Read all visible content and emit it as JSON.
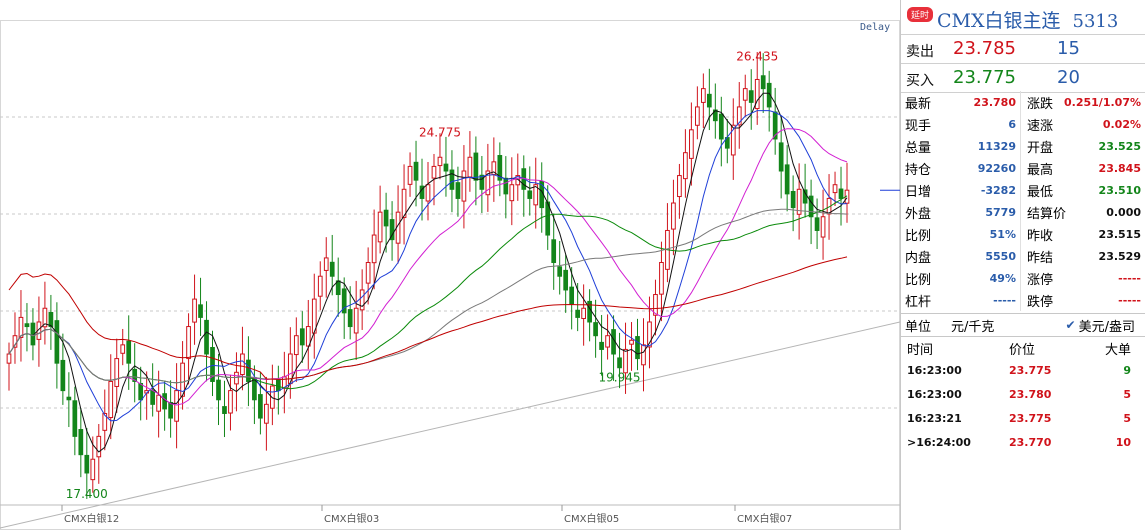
{
  "chart_data": {
    "type": "candlestick",
    "delay_label": "Delay",
    "x_labels": [
      "CMX白银12",
      "CMX白银03",
      "CMX白银05",
      "CMX白银07"
    ],
    "extrema_labels": [
      {
        "text": "17.400",
        "value": 17.4,
        "kind": "low"
      },
      {
        "text": "24.775",
        "value": 24.775,
        "kind": "high"
      },
      {
        "text": "19.945",
        "value": 19.945,
        "kind": "low"
      },
      {
        "text": "26.435",
        "value": 26.435,
        "kind": "high"
      }
    ],
    "y_range": [
      16.9,
      27.5
    ],
    "grid": true,
    "last_price": 23.78,
    "ma_colors": [
      "#111111",
      "#1f3fd8",
      "#d21fd2",
      "#0a8a0a",
      "#7a7a7a",
      "#c00000"
    ],
    "up_color": "#d0131b",
    "down_color": "#13851a",
    "closes": [
      20.2,
      20.6,
      21.0,
      20.8,
      20.4,
      20.9,
      21.2,
      20.8,
      20.0,
      19.4,
      19.2,
      18.4,
      18.0,
      17.6,
      17.9,
      18.4,
      18.9,
      19.6,
      20.1,
      20.4,
      20.0,
      19.6,
      19.2,
      19.4,
      19.1,
      19.3,
      19.0,
      18.8,
      19.4,
      20.0,
      20.8,
      21.4,
      21.0,
      20.2,
      19.6,
      19.2,
      18.9,
      19.4,
      19.8,
      20.2,
      19.6,
      19.2,
      18.8,
      19.1,
      19.5,
      19.4,
      19.7,
      20.2,
      20.6,
      20.4,
      20.8,
      21.4,
      21.9,
      22.3,
      21.9,
      21.5,
      21.1,
      20.8,
      21.2,
      21.6,
      22.2,
      22.8,
      23.3,
      23.0,
      22.7,
      23.3,
      23.8,
      24.3,
      24.0,
      23.6,
      23.9,
      24.3,
      24.5,
      24.2,
      23.8,
      23.6,
      24.2,
      24.5,
      24.0,
      23.8,
      24.2,
      24.4,
      24.0,
      23.7,
      23.9,
      24.1,
      23.8,
      23.6,
      23.9,
      23.4,
      22.8,
      22.2,
      21.9,
      21.6,
      21.3,
      21.0,
      21.2,
      20.9,
      20.6,
      20.3,
      20.6,
      20.2,
      19.9,
      20.3,
      20.5,
      20.1,
      20.4,
      20.9,
      21.5,
      22.2,
      22.9,
      23.5,
      24.1,
      24.6,
      25.1,
      25.6,
      26.0,
      25.6,
      25.3,
      24.9,
      24.7,
      25.2,
      25.6,
      26.0,
      25.7,
      26.2,
      26.0,
      25.6,
      24.9,
      24.2,
      23.7,
      23.4,
      23.8,
      23.5,
      23.2,
      22.9,
      23.2,
      23.6,
      23.9,
      23.6,
      23.78
    ]
  },
  "panel": {
    "tag": "延时",
    "title": "CMX白银主连",
    "code": "5313",
    "sell": {
      "label": "卖出",
      "price": "23.785",
      "volume": "15"
    },
    "buy": {
      "label": "买入",
      "price": "23.775",
      "volume": "20"
    },
    "stats": [
      {
        "l_label": "最新",
        "l_value": "23.780",
        "l_color": "red",
        "r_label": "涨跌",
        "r_value": "0.251/1.07%",
        "r_color": "red"
      },
      {
        "l_label": "现手",
        "l_value": "6",
        "l_color": "blue",
        "r_label": "速涨",
        "r_value": "0.02%",
        "r_color": "red"
      },
      {
        "l_label": "总量",
        "l_value": "11329",
        "l_color": "blue",
        "r_label": "开盘",
        "r_value": "23.525",
        "r_color": "green"
      },
      {
        "l_label": "持仓",
        "l_value": "92260",
        "l_color": "blue",
        "r_label": "最高",
        "r_value": "23.845",
        "r_color": "red"
      },
      {
        "l_label": "日增",
        "l_value": "-3282",
        "l_color": "blue",
        "r_label": "最低",
        "r_value": "23.510",
        "r_color": "green"
      },
      {
        "l_label": "外盘",
        "l_value": "5779",
        "l_color": "blue",
        "r_label": "结算价",
        "r_value": "0.000",
        "r_color": "black"
      },
      {
        "l_label": "比例",
        "l_value": "51%",
        "l_color": "blue",
        "r_label": "昨收",
        "r_value": "23.515",
        "r_color": "black"
      },
      {
        "l_label": "内盘",
        "l_value": "5550",
        "l_color": "blue",
        "r_label": "昨结",
        "r_value": "23.529",
        "r_color": "black"
      },
      {
        "l_label": "比例",
        "l_value": "49%",
        "l_color": "blue",
        "r_label": "涨停",
        "r_value": "-----",
        "r_color": "red"
      },
      {
        "l_label": "杠杆",
        "l_value": "-----",
        "l_color": "blue",
        "r_label": "跌停",
        "r_value": "-----",
        "r_color": "red"
      }
    ],
    "unit": {
      "label": "单位",
      "value": "元/千克",
      "option": "美元/盎司"
    },
    "trades_header": {
      "time": "时间",
      "price": "价位",
      "volume": "大单"
    },
    "trades": [
      {
        "time": "16:23:00",
        "price": "23.775",
        "volume": "9",
        "vol_color": "green"
      },
      {
        "time": "16:23:00",
        "price": "23.780",
        "volume": "5",
        "vol_color": "red"
      },
      {
        "time": "16:23:21",
        "price": "23.775",
        "volume": "5",
        "vol_color": "red"
      },
      {
        "time": "16:24:00",
        "price": "23.770",
        "volume": "10",
        "vol_color": "red",
        "marker": ">"
      }
    ]
  }
}
